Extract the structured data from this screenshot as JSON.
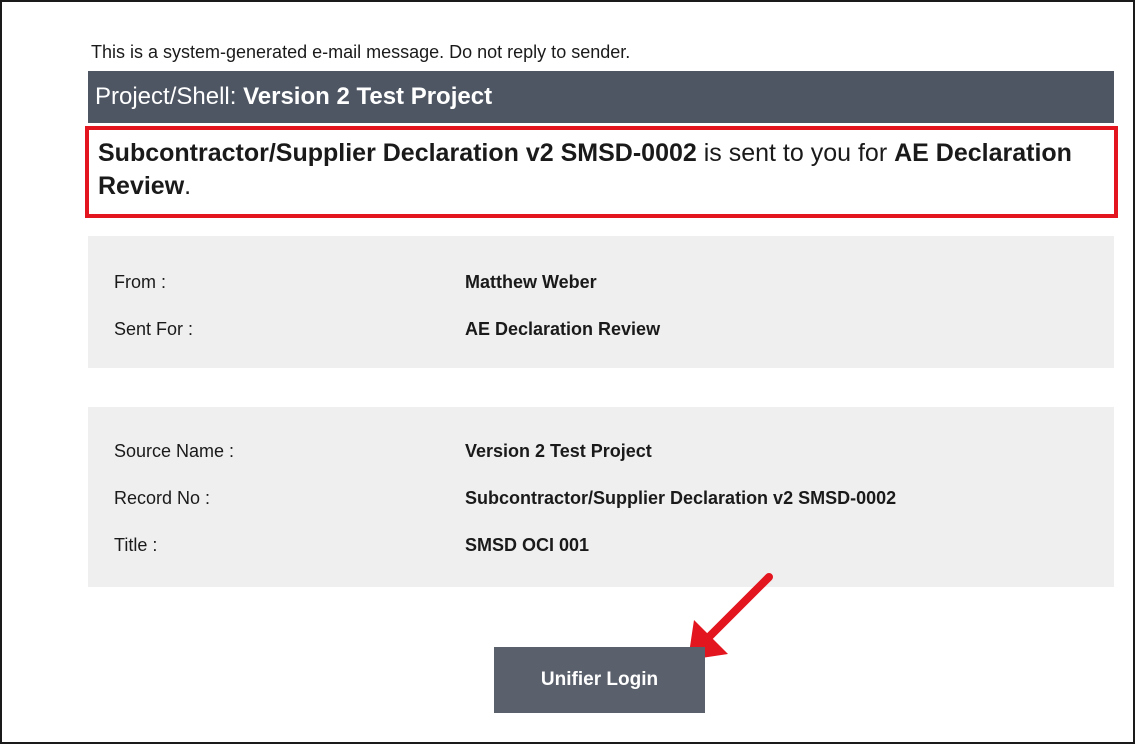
{
  "notice": "This is a system-generated e-mail message. Do not reply to sender.",
  "header": {
    "label": "Project/Shell: ",
    "project_name": "Version 2 Test Project"
  },
  "message": {
    "record": "Subcontractor/Supplier Declaration v2 SMSD-0002",
    "middle": " is sent to you for ",
    "step": "AE Declaration Review",
    "end": "."
  },
  "routing": {
    "from_label": "From :",
    "from_value": "Matthew Weber",
    "sent_for_label": "Sent For :",
    "sent_for_value": "AE Declaration Review"
  },
  "record_details": {
    "source_name_label": "Source Name :",
    "source_name_value": "Version 2 Test Project",
    "record_no_label": "Record No :",
    "record_no_value": "Subcontractor/Supplier Declaration v2 SMSD-0002",
    "title_label": "Title :",
    "title_value": "SMSD OCI 001"
  },
  "login_button": "Unifier Login",
  "colors": {
    "header_bg": "#4e5664",
    "highlight_border": "#e3151e",
    "panel_bg": "#efefef",
    "button_bg": "#5a606c",
    "arrow": "#e3151e"
  },
  "icons": {
    "annotation_arrow": "red-arrow-icon"
  }
}
